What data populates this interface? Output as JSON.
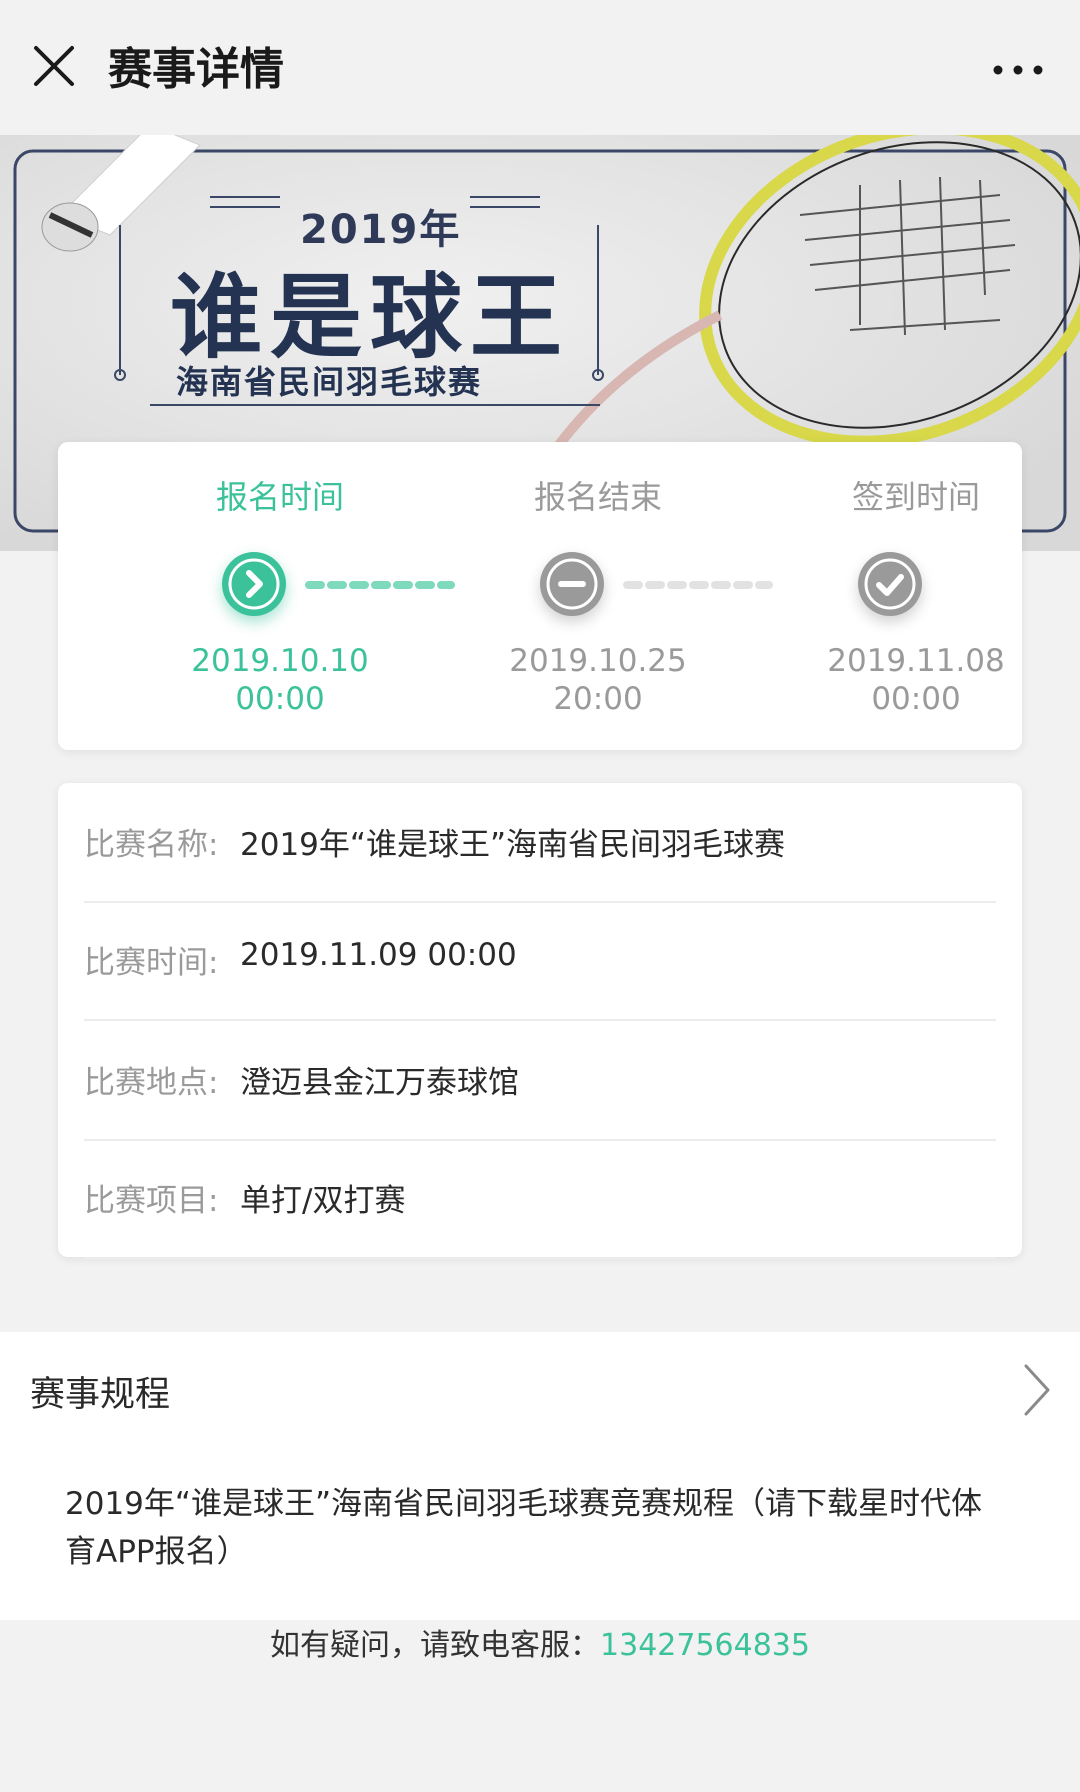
{
  "header": {
    "title": "赛事详情",
    "close_icon": "close-icon",
    "more_icon": "more-icon"
  },
  "banner": {
    "year": "2019年",
    "main_title": "谁是球王",
    "subtitle": "海南省民间羽毛球赛"
  },
  "timeline": {
    "steps": [
      {
        "label": "报名时间",
        "date": "2019.10.10",
        "time": "00:00",
        "state": "active",
        "icon": "arrow-right-icon"
      },
      {
        "label": "报名结束",
        "date": "2019.10.25",
        "time": "20:00",
        "state": "inactive",
        "icon": "minus-icon"
      },
      {
        "label": "签到时间",
        "date": "2019.11.08",
        "time": "00:00",
        "state": "inactive",
        "icon": "check-icon"
      }
    ]
  },
  "info": {
    "rows": [
      {
        "key": "比赛名称:",
        "value": "2019年“谁是球王”海南省民间羽毛球赛"
      },
      {
        "key": "比赛时间:",
        "value": "2019.11.09 00:00"
      },
      {
        "key": "比赛地点:",
        "value": "澄迈县金江万泰球馆"
      },
      {
        "key": "比赛项目:",
        "value": "单打/双打赛"
      }
    ]
  },
  "rules": {
    "title": "赛事规程",
    "body": "2019年“谁是球王”海南省民间羽毛球赛竞赛规程（请下载星时代体育APP报名）"
  },
  "footer": {
    "text": "如有疑问，请致电客服：",
    "phone": "13427564835"
  },
  "colors": {
    "accent": "#3cc29a",
    "muted": "#9a9a9a",
    "background": "#f2f2f2"
  }
}
